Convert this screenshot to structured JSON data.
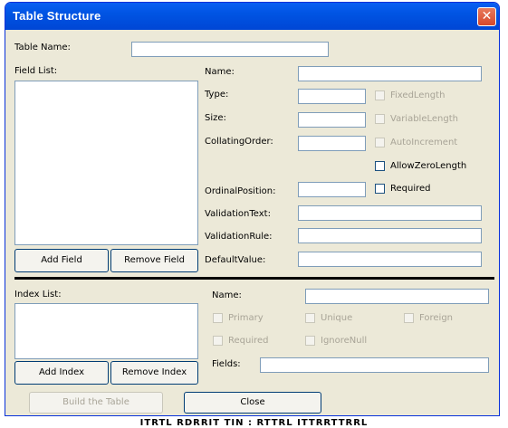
{
  "window": {
    "title": "Table Structure",
    "close_glyph": "✕"
  },
  "table_name": {
    "label": "Table Name:",
    "value": ""
  },
  "field_list": {
    "label": "Field List:",
    "items": []
  },
  "field_buttons": {
    "add": "Add Field",
    "remove": "Remove Field"
  },
  "field_props": {
    "name": "Name:",
    "type": "Type:",
    "size": "Size:",
    "collating_order": "CollatingOrder:",
    "ordinal_position": "OrdinalPosition:",
    "validation_text": "ValidationText:",
    "validation_rule": "ValidationRule:",
    "default_value": "DefaultValue:"
  },
  "field_checks": {
    "fixed_length": "FixedLength",
    "variable_length": "VariableLength",
    "auto_increment": "AutoIncrement",
    "allow_zero_length": "AllowZeroLength",
    "required": "Required"
  },
  "index_list": {
    "label": "Index List:",
    "items": []
  },
  "index_props": {
    "name": "Name:",
    "fields": "Fields:"
  },
  "index_checks": {
    "primary": "Primary",
    "unique": "Unique",
    "foreign": "Foreign",
    "required": "Required",
    "ignore_null": "IgnoreNull"
  },
  "index_buttons": {
    "add": "Add Index",
    "remove": "Remove Index"
  },
  "bottom_buttons": {
    "build": "Build the Table",
    "close": "Close"
  },
  "caption": "ITRTL RDRRIT TIN : RTTRL ITTRRTTRRL"
}
